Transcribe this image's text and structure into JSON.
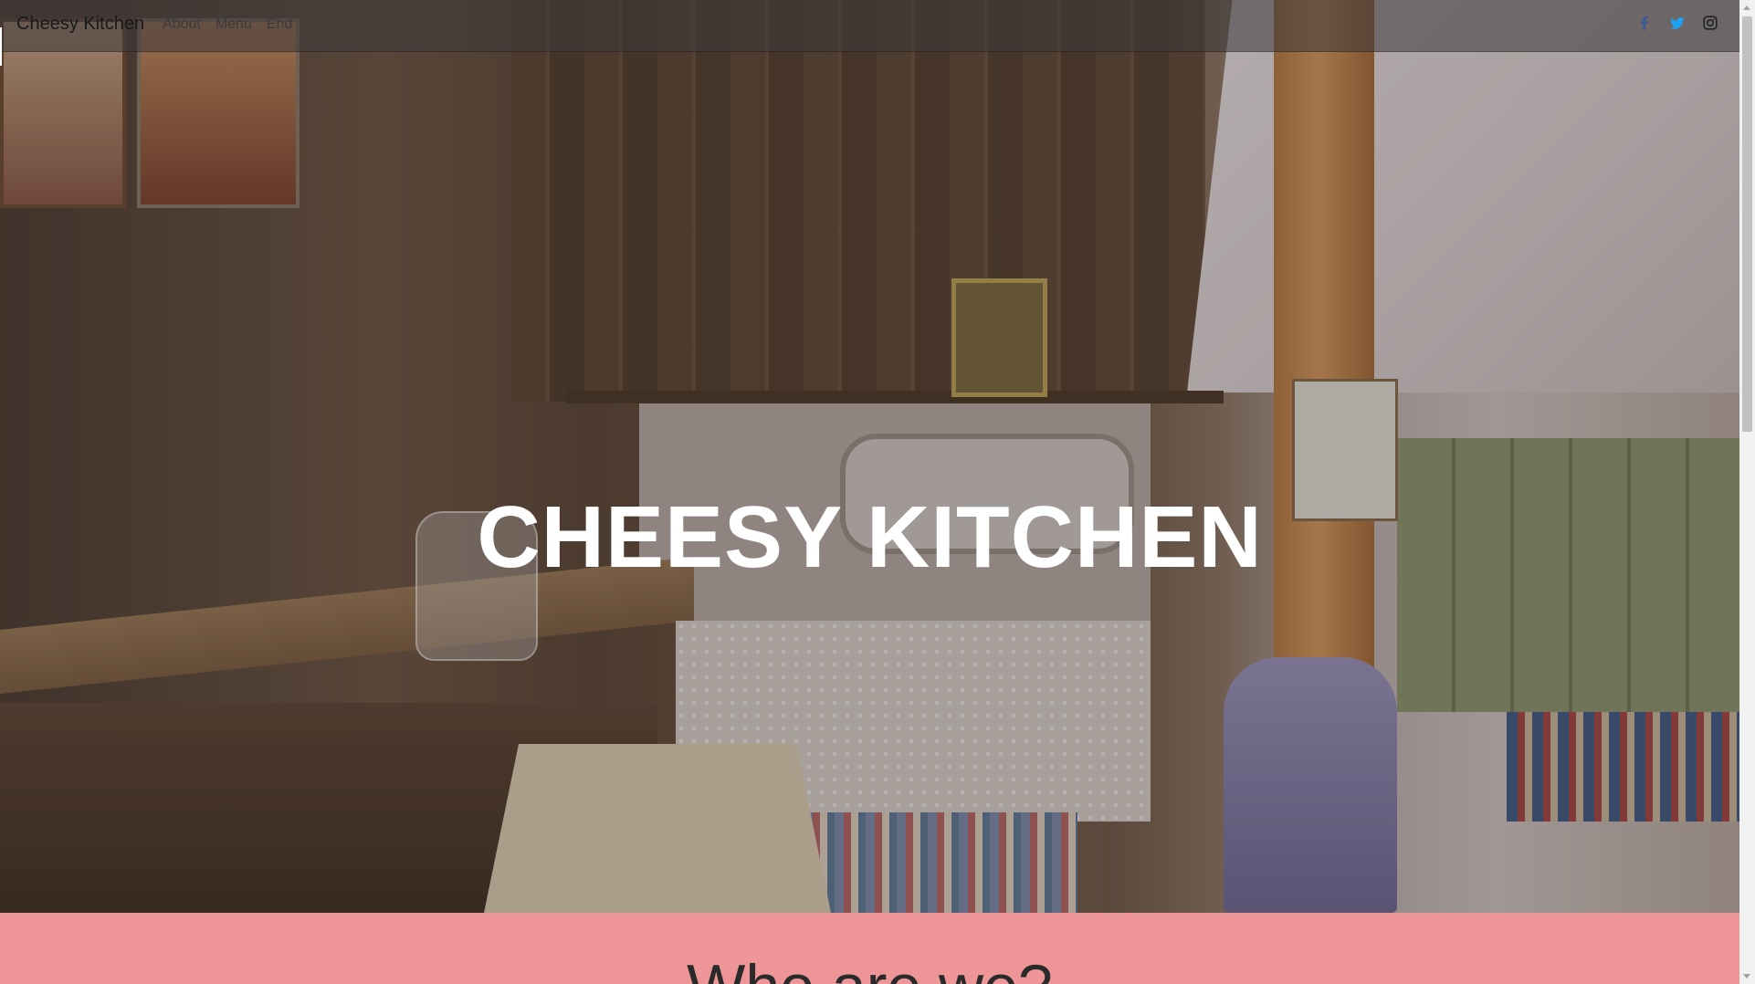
{
  "navbar": {
    "brand": "Cheesy Kitchen",
    "links": [
      "About",
      "Menu",
      "End"
    ],
    "social": [
      {
        "name": "facebook-icon",
        "color": "#3b5998"
      },
      {
        "name": "twitter-icon",
        "color": "#1da1f2"
      },
      {
        "name": "instagram-icon",
        "color": "#222222"
      }
    ]
  },
  "hero": {
    "title": "CHEESY KITCHEN",
    "background": "kitchen-photo"
  },
  "about": {
    "heading": "Who are we?",
    "background_color": "#ee9598"
  }
}
